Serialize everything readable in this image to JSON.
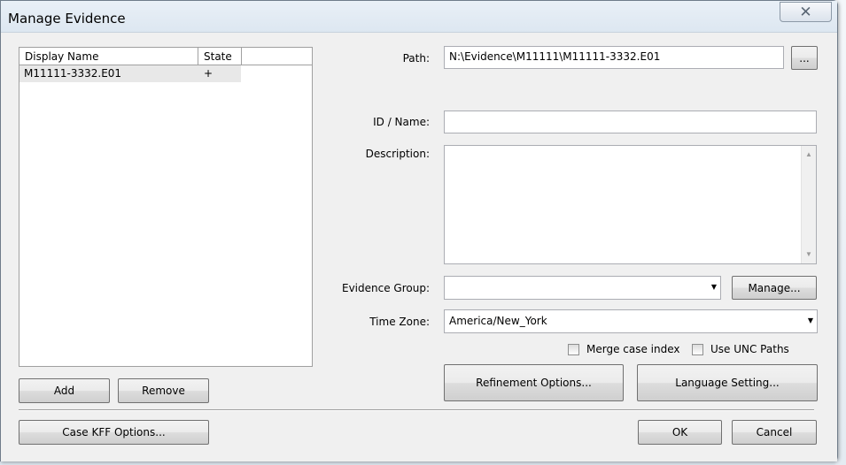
{
  "window": {
    "title": "Manage Evidence",
    "close_glyph": "✕"
  },
  "evidence_list": {
    "columns": [
      "Display Name",
      "State"
    ],
    "rows": [
      {
        "display_name": "M11111-3332.E01",
        "state": "+"
      }
    ]
  },
  "list_buttons": {
    "add": "Add",
    "remove": "Remove"
  },
  "form": {
    "path_label": "Path:",
    "path_value": "N:\\Evidence\\M11111\\M11111-3332.E01",
    "browse_label": "...",
    "id_name_label": "ID / Name:",
    "id_name_value": "",
    "description_label": "Description:",
    "description_value": "",
    "evidence_group_label": "Evidence Group:",
    "evidence_group_value": "",
    "manage_label": "Manage...",
    "time_zone_label": "Time Zone:",
    "time_zone_value": "America/New_York",
    "merge_case_index_label": "Merge case index",
    "merge_case_index_checked": false,
    "use_unc_paths_label": "Use UNC Paths",
    "use_unc_paths_checked": false,
    "refinement_options_label": "Refinement Options...",
    "language_setting_label": "Language Setting..."
  },
  "footer": {
    "case_kff_label": "Case KFF Options...",
    "ok_label": "OK",
    "cancel_label": "Cancel"
  }
}
